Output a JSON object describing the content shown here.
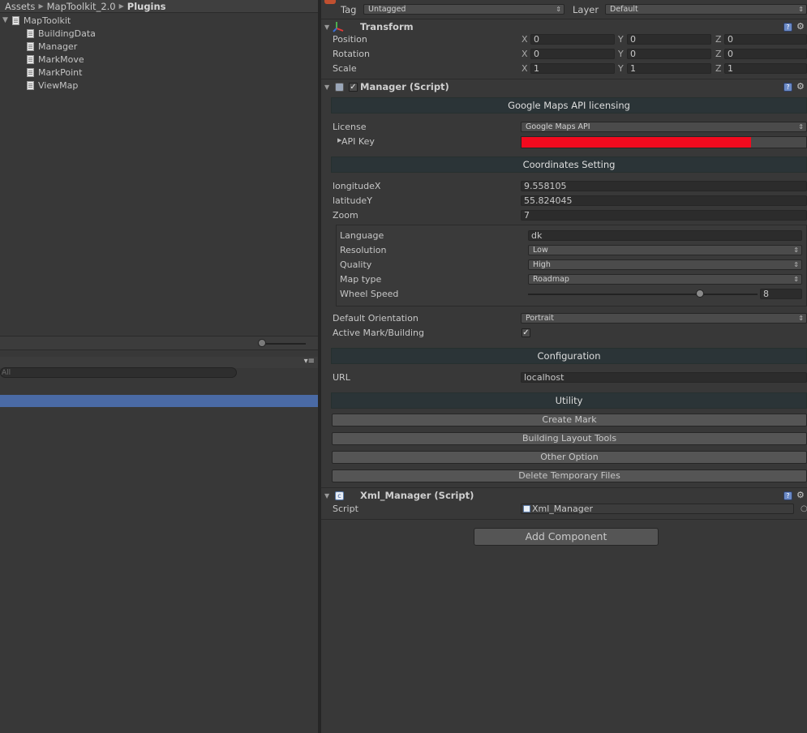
{
  "project": {
    "breadcrumb": [
      "Assets",
      "MapToolkit_2.0",
      "Plugins"
    ],
    "tree_root": "MapToolkit",
    "tree_items": [
      "BuildingData",
      "Manager",
      "MarkMove",
      "MarkPoint",
      "ViewMap"
    ],
    "search_placeholder": "All",
    "menu_glyph": "▾≡"
  },
  "inspector": {
    "tag_label": "Tag",
    "tag_value": "Untagged",
    "layer_label": "Layer",
    "layer_value": "Default",
    "transform": {
      "title": "Transform",
      "rows": [
        {
          "label": "Position",
          "x": "0",
          "y": "0",
          "z": "0"
        },
        {
          "label": "Rotation",
          "x": "0",
          "y": "0",
          "z": "0"
        },
        {
          "label": "Scale",
          "x": "1",
          "y": "1",
          "z": "1"
        }
      ],
      "axis_labels": [
        "X",
        "Y",
        "Z"
      ]
    },
    "manager": {
      "title": "Manager (Script)",
      "enabled": true,
      "licensing_header": "Google Maps API licensing",
      "license_label": "License",
      "license_value": "Google Maps API",
      "apikey_label": "API Key",
      "coords_header": "Coordinates Setting",
      "longitude_label": "longitudeX",
      "longitude_value": "9.558105",
      "latitude_label": "latitudeY",
      "latitude_value": "55.824045",
      "zoom_label": "Zoom",
      "zoom_value": "7",
      "language_label": "Language",
      "language_value": "dk",
      "resolution_label": "Resolution",
      "resolution_value": "Low",
      "quality_label": "Quality",
      "quality_value": "High",
      "maptype_label": "Map type",
      "maptype_value": "Roadmap",
      "wheel_label": "Wheel Speed",
      "wheel_value": "8",
      "wheel_fraction": 0.75,
      "orientation_label": "Default Orientation",
      "orientation_value": "Portrait",
      "activemark_label": "Active Mark/Building",
      "activemark_checked": true,
      "config_header": "Configuration",
      "url_label": "URL",
      "url_value": "localhost",
      "utility_header": "Utility",
      "buttons": [
        "Create Mark",
        "Building Layout Tools",
        "Other Option",
        "Delete Temporary Files"
      ]
    },
    "xml_manager": {
      "title": "Xml_Manager (Script)",
      "script_label": "Script",
      "script_value": "Xml_Manager"
    },
    "add_component": "Add Component",
    "colors": {
      "api_key_bar": "#f20a1e",
      "section_header": "#2b3437",
      "selection": "#4a6aa5"
    }
  }
}
